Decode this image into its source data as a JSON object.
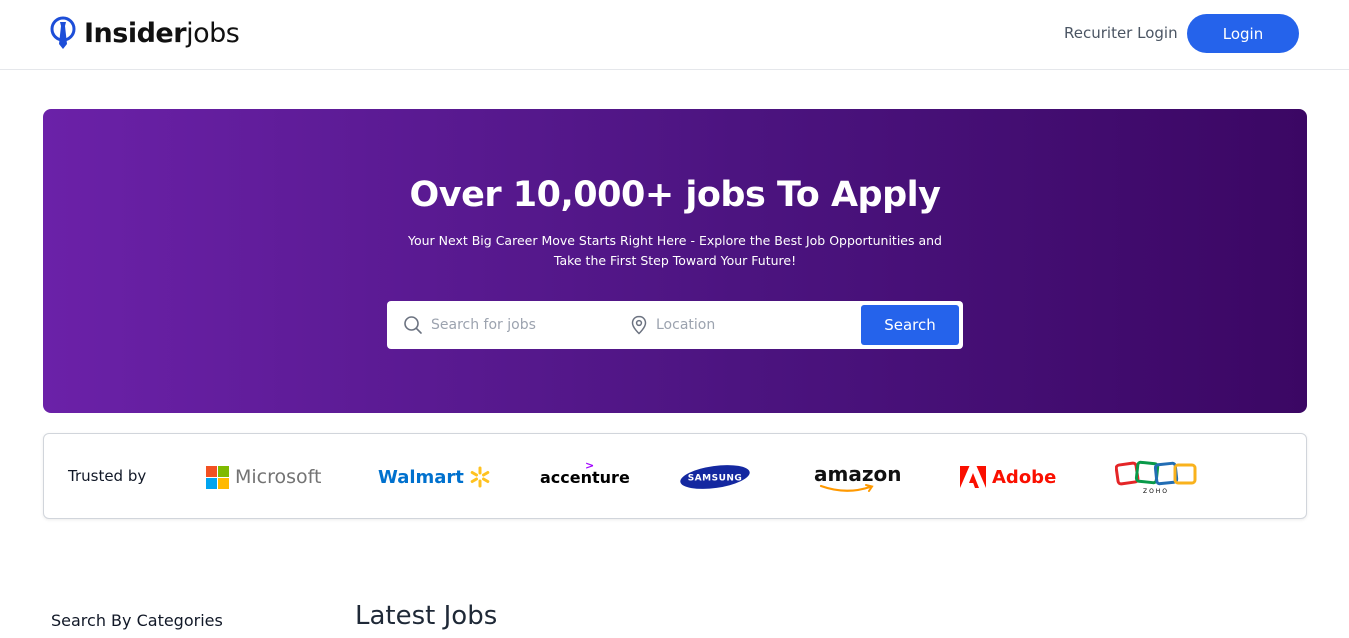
{
  "header": {
    "logo_bold": "Insider",
    "logo_light": "jobs",
    "recruiter_login": "Recuriter Login",
    "login": "Login"
  },
  "hero": {
    "title": "Over 10,000+ jobs To Apply",
    "subtitle_line1": "Your Next Big Career Move Starts Right Here - Explore the Best Job Opportunities and",
    "subtitle_line2": "Take the First Step Toward Your Future!",
    "search_placeholder": "Search for jobs",
    "location_placeholder": "Location",
    "search_button": "Search"
  },
  "trusted": {
    "label": "Trusted by",
    "brands": [
      "Microsoft",
      "Walmart",
      "accenture",
      "SAMSUNG",
      "amazon",
      "Adobe",
      "ZOHO"
    ]
  },
  "sections": {
    "categories_title": "Search By Categories",
    "latest_title": "Latest Jobs"
  },
  "colors": {
    "primary": "#2563eb",
    "hero_start": "#6b21a8",
    "hero_end": "#3b0764"
  },
  "icons": [
    "logo-icon",
    "search-icon",
    "location-pin-icon"
  ]
}
